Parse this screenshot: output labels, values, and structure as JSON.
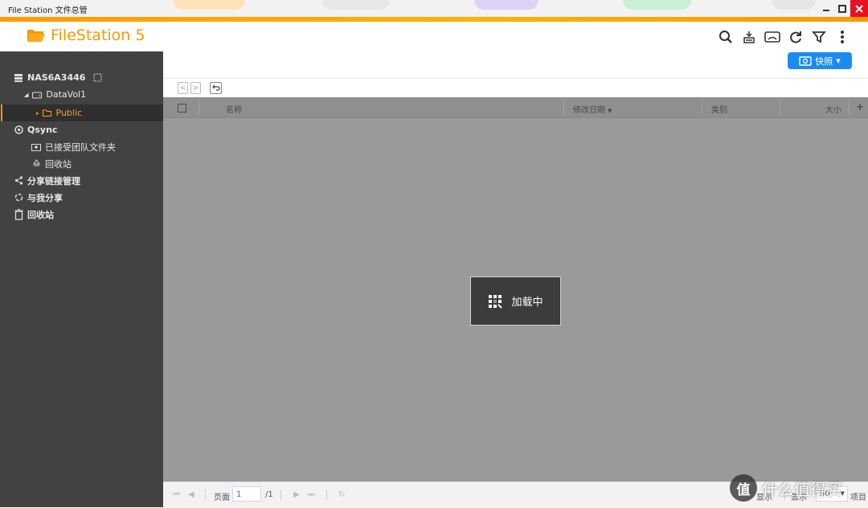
{
  "window": {
    "title": "File Station 文件总管"
  },
  "app": {
    "name": "FileStation 5",
    "accent": "#f59a00"
  },
  "toolbar": {
    "icons": [
      "search-icon",
      "remote-mount-icon",
      "media-cast-icon",
      "refresh-icon",
      "filter-icon",
      "more-icon"
    ],
    "snapshot_label": "快照"
  },
  "sidebar": {
    "nas_name": "NAS6A3446",
    "volume": "DataVol1",
    "folder": "Public",
    "qsync": "Qsync",
    "team_folder": "已接受团队文件夹",
    "qsync_recycle": "回收站",
    "share_links": "分享链接管理",
    "shared_with_me": "与我分享",
    "recycle_bin": "回收站"
  },
  "table": {
    "columns": {
      "name": "名称",
      "modified": "修改日期",
      "type": "类别",
      "size": "大小"
    }
  },
  "loading": {
    "text": "加载中"
  },
  "footer": {
    "page_label": "页面",
    "page_value": "1",
    "page_total": "/1",
    "display_label": "显示",
    "show_label": "显示",
    "page_size": "50",
    "items_label": "项目"
  },
  "watermark": {
    "badge": "值",
    "text": "什么值得买"
  }
}
